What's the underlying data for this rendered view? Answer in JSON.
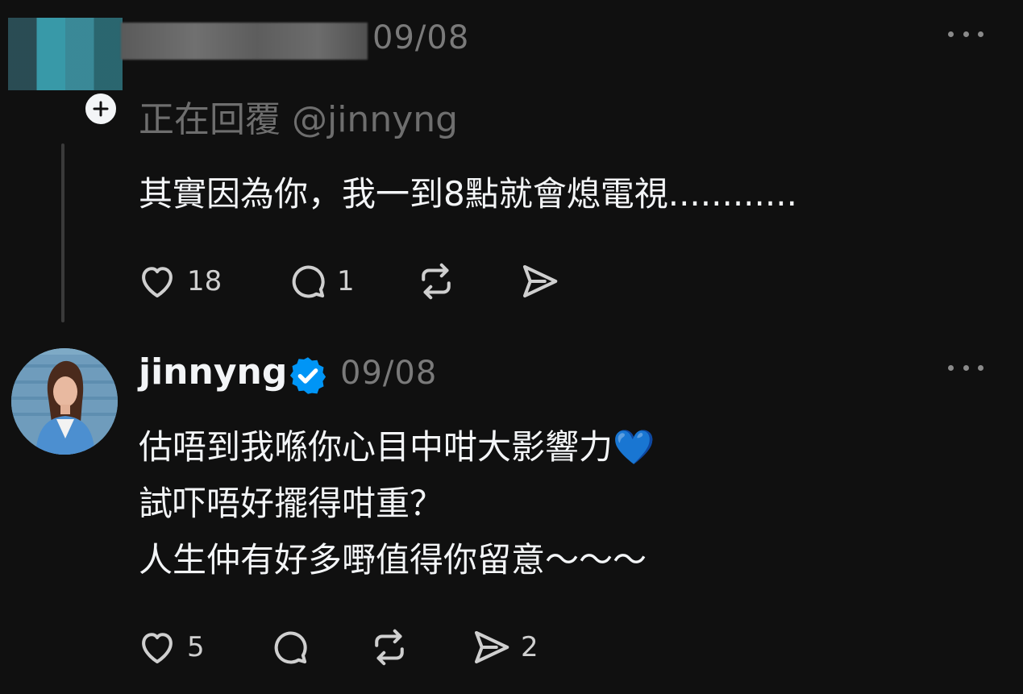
{
  "posts": [
    {
      "timestamp": "09/08",
      "replying_to": "正在回覆 @jinnyng",
      "text": "其實因為你，我一到8點就會熄電視............",
      "actions": {
        "likes": "18",
        "replies": "1",
        "reposts": "",
        "shares": ""
      }
    },
    {
      "username": "jinnyng",
      "verified": true,
      "timestamp": "09/08",
      "lines": [
        "估唔到我喺你心目中咁大影響力💙",
        "試吓唔好擺得咁重？",
        "人生仲有好多嘢值得你留意～～～"
      ],
      "actions": {
        "likes": "5",
        "replies": "",
        "reposts": "",
        "shares": "2"
      }
    }
  ],
  "icons": [
    "heart-icon",
    "comment-icon",
    "repost-icon",
    "share-icon",
    "more-icon",
    "plus-icon",
    "verified-badge-icon"
  ],
  "colors": {
    "background": "#101010",
    "text": "#f3f5f7",
    "muted": "#7a7a7a",
    "verified": "#0095f6"
  }
}
